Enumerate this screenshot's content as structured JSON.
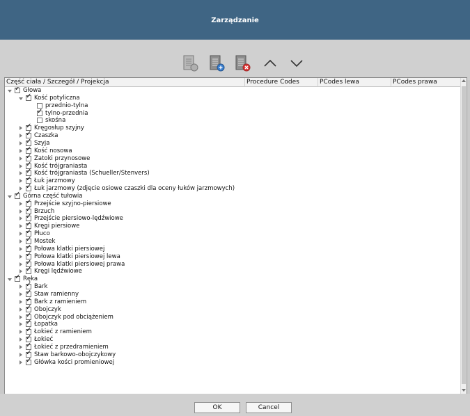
{
  "window": {
    "title": "Zarządzanie"
  },
  "toolbar": {
    "buttons": [
      {
        "name": "add-icon"
      },
      {
        "name": "edit-icon"
      },
      {
        "name": "delete-icon"
      },
      {
        "name": "move-up-icon"
      },
      {
        "name": "move-down-icon"
      }
    ]
  },
  "table": {
    "columns": [
      "Część ciała / Szczegół / Projekcja",
      "Procedure Codes",
      "PCodes lewa",
      "PCodes prawa"
    ],
    "rows": [
      {
        "level": 0,
        "arrow": "expanded",
        "checked": true,
        "label": "Głowa"
      },
      {
        "level": 1,
        "arrow": "expanded",
        "checked": true,
        "label": "Kość potyliczna"
      },
      {
        "level": 2,
        "arrow": "none",
        "checked": false,
        "label": "przednio-tylna"
      },
      {
        "level": 2,
        "arrow": "none",
        "checked": true,
        "label": "tylno-przednia"
      },
      {
        "level": 2,
        "arrow": "none",
        "checked": false,
        "label": "skośna"
      },
      {
        "level": 1,
        "arrow": "collapsed",
        "checked": true,
        "label": "Kręgosłup szyjny"
      },
      {
        "level": 1,
        "arrow": "collapsed",
        "checked": true,
        "label": "Czaszka"
      },
      {
        "level": 1,
        "arrow": "collapsed",
        "checked": true,
        "label": "Szyja"
      },
      {
        "level": 1,
        "arrow": "collapsed",
        "checked": true,
        "label": "Kość nosowa"
      },
      {
        "level": 1,
        "arrow": "collapsed",
        "checked": true,
        "label": "Zatoki przynosowe"
      },
      {
        "level": 1,
        "arrow": "collapsed",
        "checked": true,
        "label": "Kość trójgraniasta"
      },
      {
        "level": 1,
        "arrow": "collapsed",
        "checked": true,
        "label": "Kość trójgraniasta (Schueller/Stenvers)"
      },
      {
        "level": 1,
        "arrow": "collapsed",
        "checked": true,
        "label": "Łuk jarzmowy"
      },
      {
        "level": 1,
        "arrow": "collapsed",
        "checked": true,
        "label": "Łuk jarzmowy (zdjęcie osiowe czaszki dla oceny łuków jarzmowych)"
      },
      {
        "level": 0,
        "arrow": "expanded",
        "checked": true,
        "label": "Górna część tułowia"
      },
      {
        "level": 1,
        "arrow": "collapsed",
        "checked": true,
        "label": "Przejście szyjno-piersiowe"
      },
      {
        "level": 1,
        "arrow": "collapsed",
        "checked": true,
        "label": "Brzuch"
      },
      {
        "level": 1,
        "arrow": "collapsed",
        "checked": true,
        "label": "Przejście piersiowo-lędźwiowe"
      },
      {
        "level": 1,
        "arrow": "collapsed",
        "checked": true,
        "label": "Kręgi piersiowe"
      },
      {
        "level": 1,
        "arrow": "collapsed",
        "checked": true,
        "label": "Płuco"
      },
      {
        "level": 1,
        "arrow": "collapsed",
        "checked": true,
        "label": "Mostek"
      },
      {
        "level": 1,
        "arrow": "collapsed",
        "checked": true,
        "label": "Połowa klatki piersiowej"
      },
      {
        "level": 1,
        "arrow": "collapsed",
        "checked": true,
        "label": "Połowa klatki piersiowej lewa"
      },
      {
        "level": 1,
        "arrow": "collapsed",
        "checked": true,
        "label": "Połowa klatki piersiowej prawa"
      },
      {
        "level": 1,
        "arrow": "collapsed",
        "checked": true,
        "label": "Kręgi lędźwiowe"
      },
      {
        "level": 0,
        "arrow": "expanded",
        "checked": true,
        "label": "Ręka"
      },
      {
        "level": 1,
        "arrow": "collapsed",
        "checked": true,
        "label": "Bark"
      },
      {
        "level": 1,
        "arrow": "collapsed",
        "checked": true,
        "label": "Staw ramienny"
      },
      {
        "level": 1,
        "arrow": "collapsed",
        "checked": true,
        "label": "Bark z ramieniem"
      },
      {
        "level": 1,
        "arrow": "collapsed",
        "checked": true,
        "label": "Obojczyk"
      },
      {
        "level": 1,
        "arrow": "collapsed",
        "checked": true,
        "label": "Obojczyk pod obciążeniem"
      },
      {
        "level": 1,
        "arrow": "collapsed",
        "checked": true,
        "label": "Łopatka"
      },
      {
        "level": 1,
        "arrow": "collapsed",
        "checked": true,
        "label": "Łokieć z ramieniem"
      },
      {
        "level": 1,
        "arrow": "collapsed",
        "checked": true,
        "label": "Łokieć"
      },
      {
        "level": 1,
        "arrow": "collapsed",
        "checked": true,
        "label": "Łokieć z przedramieniem"
      },
      {
        "level": 1,
        "arrow": "collapsed",
        "checked": true,
        "label": "Staw barkowo-obojczykowy"
      },
      {
        "level": 1,
        "arrow": "collapsed",
        "checked": true,
        "label": "Główka kości promieniowej"
      }
    ]
  },
  "footer": {
    "ok_label": "OK",
    "cancel_label": "Cancel"
  },
  "colors": {
    "titlebar": "#3f6584",
    "background": "#c9c9c9"
  }
}
